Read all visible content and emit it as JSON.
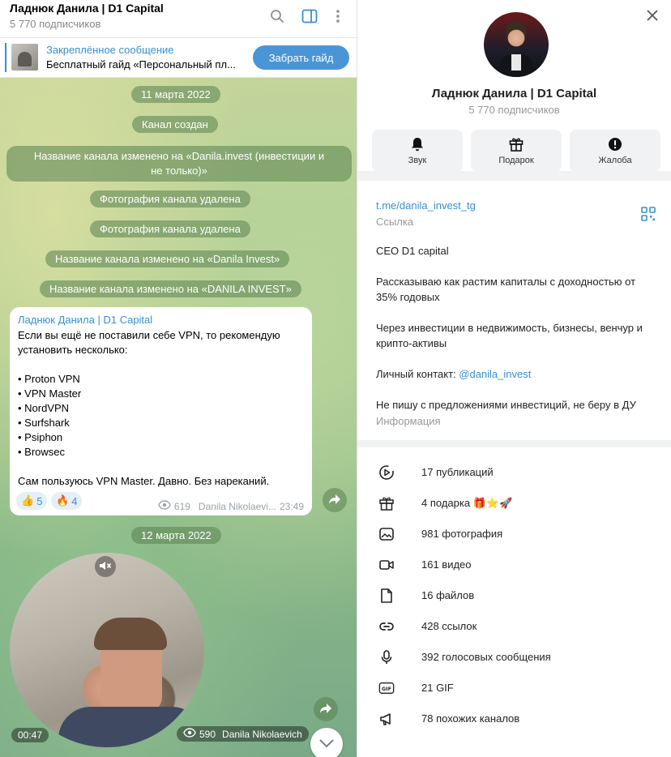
{
  "chat": {
    "title": "Ладнюк Данила | D1 Capital",
    "subscribers": "5 770 подписчиков"
  },
  "pinned": {
    "title": "Закреплённое сообщение",
    "text": "Бесплатный гайд «Персональный пл...",
    "button": "Забрать гайд"
  },
  "service": {
    "date1": "11 марта 2022",
    "created": "Канал создан",
    "rename1_line1": "Название канала изменено на «Danila.invest (инвестиции и",
    "rename1_line2": "не только)»",
    "photo_deleted_1": "Фотография канала удалена",
    "photo_deleted_2": "Фотография канала удалена",
    "rename2": "Название канала изменено на «Danila Invest»",
    "rename3": "Название канала изменено на «DANILA INVEST»",
    "date2": "12 марта 2022"
  },
  "post": {
    "author": "Ладнюк Данила | D1 Capital",
    "lines": [
      "Если вы ещё не поставили себе VPN, то рекомендую",
      "установить несколько:",
      "",
      "• Proton VPN",
      "• VPN Master",
      "• NordVPN",
      "• Surfshark",
      "• Psiphon",
      "• Browsec",
      "",
      "Сам пользуюсь VPN Master. Давно. Без нареканий."
    ],
    "reaction1_emoji": "👍",
    "reaction1_count": "5",
    "reaction2_emoji": "🔥",
    "reaction2_count": "4",
    "views": "619",
    "signature": "Danila Nikolaevi...",
    "time": "23:49"
  },
  "video": {
    "duration": "00:47",
    "views": "590",
    "signature": "Danila Nikolaevich"
  },
  "profile": {
    "name": "Ладнюк Данила | D1 Capital",
    "subscribers": "5 770 подписчиков",
    "actions": {
      "sound": "Звук",
      "gift": "Подарок",
      "report": "Жалоба"
    },
    "link": "t.me/danila_invest_tg",
    "link_label": "Ссылка",
    "description": [
      "CEO D1 capital",
      "",
      "Рассказываю как растим капиталы с доходностью от",
      "35% годовых",
      "",
      "Через инвестиции в недвижимость, бизнесы, венчур и",
      "крипто-активы",
      ""
    ],
    "contact_prefix": "Личный контакт: ",
    "contact_handle": "@danila_invest",
    "last_line": "Не пишу с предложениями инвестиций, не беру в ДУ",
    "info_label": "Информация"
  },
  "stats": [
    {
      "icon": "publications-icon",
      "label": "17 публикаций"
    },
    {
      "icon": "gift-icon",
      "label": "4 подарка 🎁⭐🚀"
    },
    {
      "icon": "photo-icon",
      "label": "981 фотография"
    },
    {
      "icon": "video-icon",
      "label": "161 видео"
    },
    {
      "icon": "file-icon",
      "label": "16 файлов"
    },
    {
      "icon": "link-icon",
      "label": "428 ссылок"
    },
    {
      "icon": "microphone-icon",
      "label": "392 голосовых сообщения"
    },
    {
      "icon": "gif-icon",
      "label": "21 GIF"
    },
    {
      "icon": "megaphone-icon",
      "label": "78 похожих каналов"
    }
  ],
  "colors": {
    "accent": "#3a8fd1",
    "button": "#4a95d6",
    "service_bubble": "rgba(90,130,80,0.55)"
  }
}
